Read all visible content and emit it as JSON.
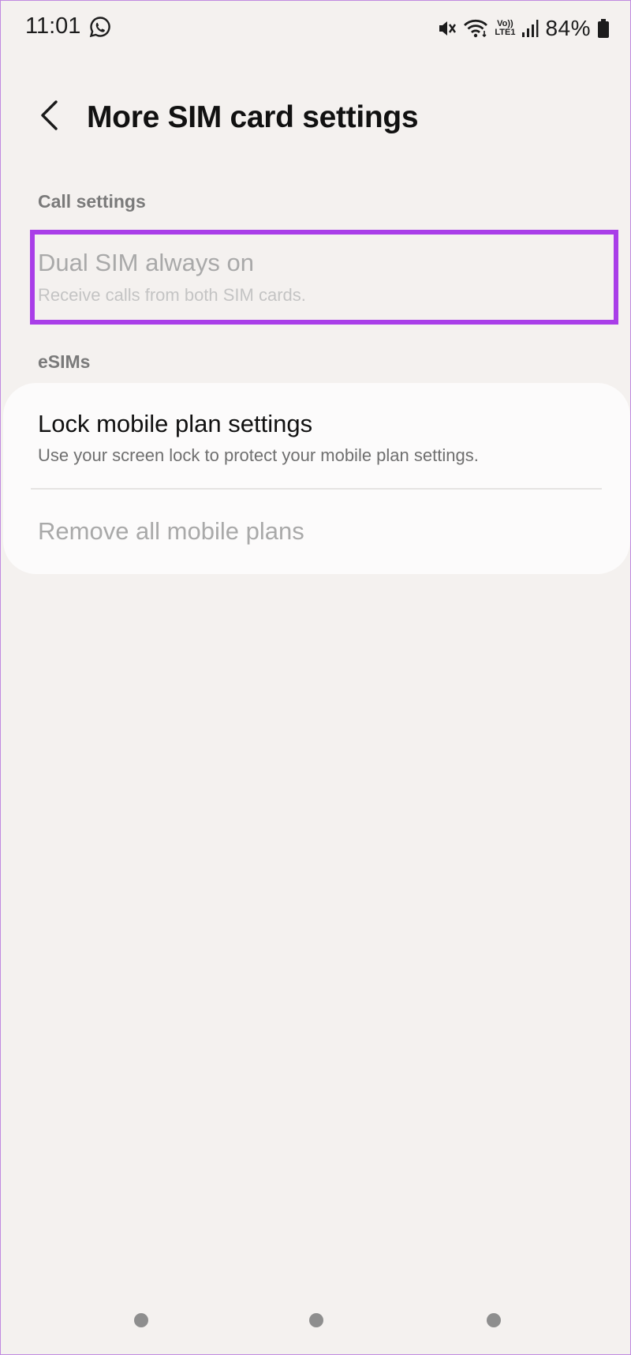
{
  "status_bar": {
    "time": "11:01",
    "network_label_top": "Vo))",
    "network_label_bottom": "LTE1",
    "battery_percent": "84%"
  },
  "header": {
    "title": "More SIM card settings"
  },
  "sections": {
    "call_settings": {
      "label": "Call settings",
      "items": [
        {
          "title": "Dual SIM always on",
          "subtitle": "Receive calls from both SIM cards."
        }
      ]
    },
    "esims": {
      "label": "eSIMs",
      "items": [
        {
          "title": "Lock mobile plan settings",
          "subtitle": "Use your screen lock to protect your mobile plan settings."
        },
        {
          "title": "Remove all mobile plans"
        }
      ]
    }
  },
  "colors": {
    "background": "#f4f1ef",
    "card": "#fcfbfb",
    "highlight": "#a93ee8",
    "disabled_text": "#a9a9a9",
    "section_label": "#7a7a7a"
  },
  "icons": {
    "whatsapp": "whatsapp-icon",
    "mute": "mute-icon",
    "wifi": "wifi-icon",
    "signal": "signal-icon",
    "battery": "battery-icon",
    "back": "back-arrow-icon"
  }
}
